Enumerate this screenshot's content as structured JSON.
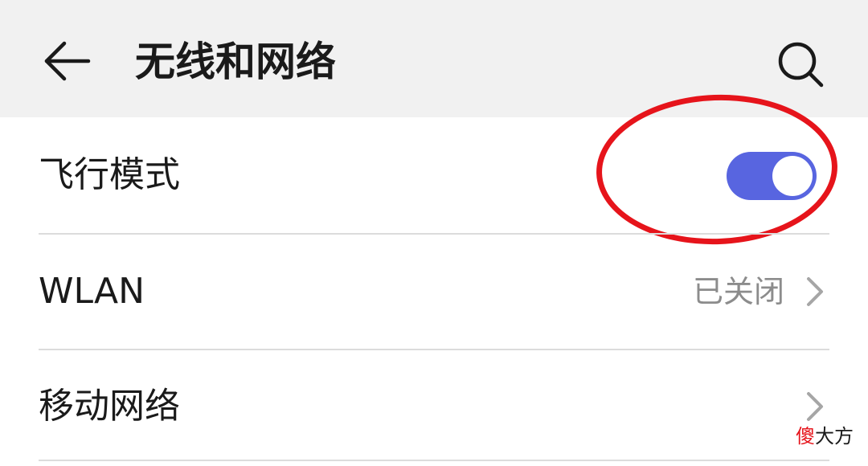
{
  "header": {
    "title": "无线和网络",
    "back_icon": "arrow-left-icon",
    "search_icon": "search-icon",
    "background_color": "#f1f1f1"
  },
  "settings": {
    "airplane_mode": {
      "label": "飞行模式",
      "enabled": true,
      "toggle_color": "#5865e0"
    },
    "wlan": {
      "label": "WLAN",
      "status": "已关闭",
      "chevron_icon": "chevron-right-icon"
    },
    "mobile_network": {
      "label": "移动网络",
      "chevron_icon": "chevron-right-icon"
    }
  },
  "annotation": {
    "highlight_color": "#e6141b"
  },
  "watermark": {
    "first_char": "傻",
    "rest": "大方"
  }
}
